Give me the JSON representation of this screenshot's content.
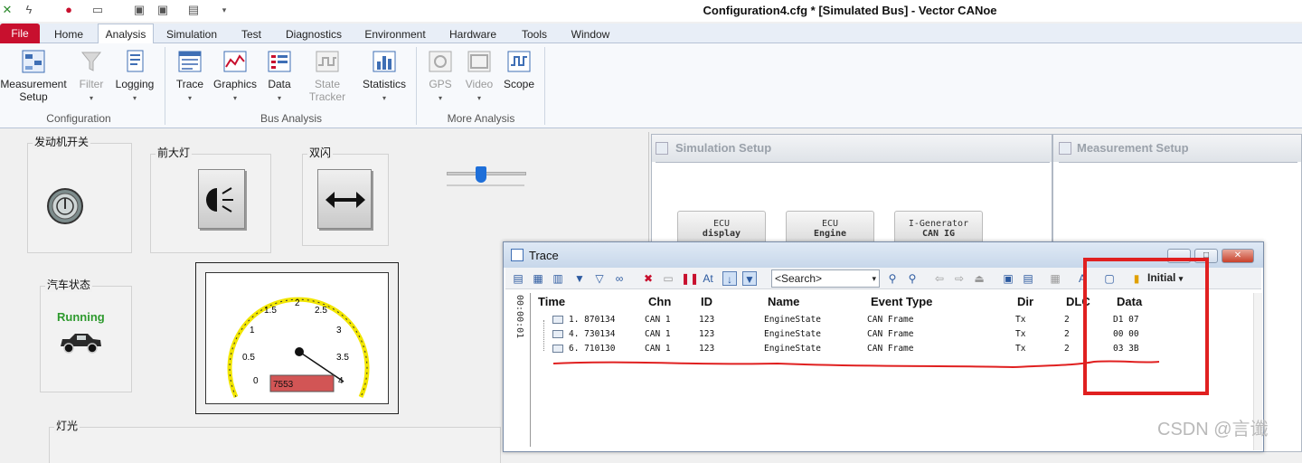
{
  "window": {
    "title": "Configuration4.cfg * [Simulated Bus] - Vector CANoe"
  },
  "ribbon_tabs": [
    "File",
    "Home",
    "Analysis",
    "Simulation",
    "Test",
    "Diagnostics",
    "Environment",
    "Hardware",
    "Tools",
    "Window"
  ],
  "active_tab": "Analysis",
  "ribbon": {
    "configuration": {
      "label": "Configuration",
      "buttons": [
        "Measurement\nSetup",
        "Filter",
        "Logging"
      ]
    },
    "bus_analysis": {
      "label": "Bus Analysis",
      "buttons": [
        "Trace",
        "Graphics",
        "Data",
        "State\nTracker",
        "Statistics"
      ]
    },
    "more_analysis": {
      "label": "More Analysis",
      "buttons": [
        "GPS",
        "Video",
        "Scope"
      ]
    }
  },
  "panel": {
    "engine_switch": "发动机开关",
    "headlight": "前大灯",
    "hazard": "双闪",
    "car_status": "汽车状态",
    "car_status_text": "Running",
    "lights": "灯光",
    "gauge": {
      "ticks": [
        "0",
        "0.5",
        "1",
        "1.5",
        "2",
        "2.5",
        "3",
        "3.5",
        "4"
      ],
      "readout": "7553"
    }
  },
  "simulation_setup": {
    "title": "Simulation Setup",
    "nodes": [
      {
        "line1": "ECU",
        "line2": "display"
      },
      {
        "line1": "ECU",
        "line2": "Engine"
      },
      {
        "line1": "I-Generator",
        "line2": "CAN IG"
      }
    ]
  },
  "measurement_setup": {
    "title": "Measurement Setup"
  },
  "trace": {
    "title": "Trace",
    "search_placeholder": "<Search>",
    "initial_label": "Initial",
    "time_axis": "00:00:01",
    "columns": [
      "Time",
      "Chn",
      "ID",
      "Name",
      "Event Type",
      "Dir",
      "DLC",
      "Data"
    ],
    "rows": [
      {
        "time": "1. 870134",
        "chn": "CAN 1",
        "id": "123",
        "name": "EngineState",
        "event": "CAN Frame",
        "dir": "Tx",
        "dlc": "2",
        "data": "D1 07"
      },
      {
        "time": "4. 730134",
        "chn": "CAN 1",
        "id": "123",
        "name": "EngineState",
        "event": "CAN Frame",
        "dir": "Tx",
        "dlc": "2",
        "data": "00 00"
      },
      {
        "time": "6. 710130",
        "chn": "CAN 1",
        "id": "123",
        "name": "EngineState",
        "event": "CAN Frame",
        "dir": "Tx",
        "dlc": "2",
        "data": "03 3B"
      }
    ]
  },
  "watermark": "CSDN @言谶",
  "colors": {
    "file_tab": "#c8102e",
    "annotation": "#e02020",
    "gauge_ring": "#f2e600",
    "running_text": "#2e9a2e",
    "readout_bg": "#d25555"
  }
}
